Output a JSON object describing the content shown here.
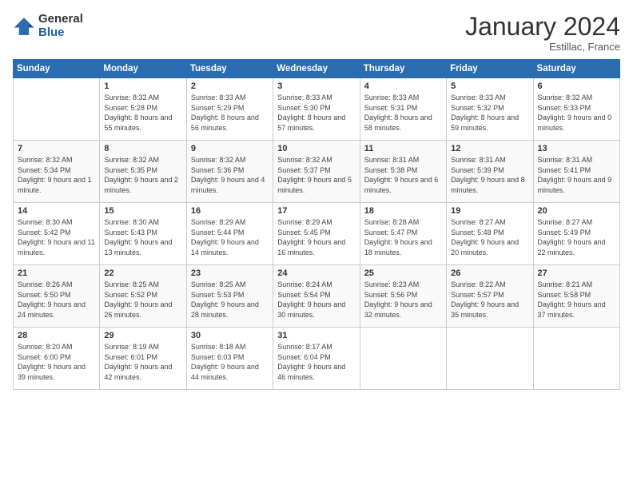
{
  "logo": {
    "general": "General",
    "blue": "Blue"
  },
  "title": "January 2024",
  "subtitle": "Estillac, France",
  "days_of_week": [
    "Sunday",
    "Monday",
    "Tuesday",
    "Wednesday",
    "Thursday",
    "Friday",
    "Saturday"
  ],
  "weeks": [
    [
      {
        "day": "",
        "sunrise": "",
        "sunset": "",
        "daylight": ""
      },
      {
        "day": "1",
        "sunrise": "Sunrise: 8:32 AM",
        "sunset": "Sunset: 5:28 PM",
        "daylight": "Daylight: 8 hours and 55 minutes."
      },
      {
        "day": "2",
        "sunrise": "Sunrise: 8:33 AM",
        "sunset": "Sunset: 5:29 PM",
        "daylight": "Daylight: 8 hours and 56 minutes."
      },
      {
        "day": "3",
        "sunrise": "Sunrise: 8:33 AM",
        "sunset": "Sunset: 5:30 PM",
        "daylight": "Daylight: 8 hours and 57 minutes."
      },
      {
        "day": "4",
        "sunrise": "Sunrise: 8:33 AM",
        "sunset": "Sunset: 5:31 PM",
        "daylight": "Daylight: 8 hours and 58 minutes."
      },
      {
        "day": "5",
        "sunrise": "Sunrise: 8:33 AM",
        "sunset": "Sunset: 5:32 PM",
        "daylight": "Daylight: 8 hours and 59 minutes."
      },
      {
        "day": "6",
        "sunrise": "Sunrise: 8:32 AM",
        "sunset": "Sunset: 5:33 PM",
        "daylight": "Daylight: 9 hours and 0 minutes."
      }
    ],
    [
      {
        "day": "7",
        "sunrise": "Sunrise: 8:32 AM",
        "sunset": "Sunset: 5:34 PM",
        "daylight": "Daylight: 9 hours and 1 minute."
      },
      {
        "day": "8",
        "sunrise": "Sunrise: 8:32 AM",
        "sunset": "Sunset: 5:35 PM",
        "daylight": "Daylight: 9 hours and 2 minutes."
      },
      {
        "day": "9",
        "sunrise": "Sunrise: 8:32 AM",
        "sunset": "Sunset: 5:36 PM",
        "daylight": "Daylight: 9 hours and 4 minutes."
      },
      {
        "day": "10",
        "sunrise": "Sunrise: 8:32 AM",
        "sunset": "Sunset: 5:37 PM",
        "daylight": "Daylight: 9 hours and 5 minutes."
      },
      {
        "day": "11",
        "sunrise": "Sunrise: 8:31 AM",
        "sunset": "Sunset: 5:38 PM",
        "daylight": "Daylight: 9 hours and 6 minutes."
      },
      {
        "day": "12",
        "sunrise": "Sunrise: 8:31 AM",
        "sunset": "Sunset: 5:39 PM",
        "daylight": "Daylight: 9 hours and 8 minutes."
      },
      {
        "day": "13",
        "sunrise": "Sunrise: 8:31 AM",
        "sunset": "Sunset: 5:41 PM",
        "daylight": "Daylight: 9 hours and 9 minutes."
      }
    ],
    [
      {
        "day": "14",
        "sunrise": "Sunrise: 8:30 AM",
        "sunset": "Sunset: 5:42 PM",
        "daylight": "Daylight: 9 hours and 11 minutes."
      },
      {
        "day": "15",
        "sunrise": "Sunrise: 8:30 AM",
        "sunset": "Sunset: 5:43 PM",
        "daylight": "Daylight: 9 hours and 13 minutes."
      },
      {
        "day": "16",
        "sunrise": "Sunrise: 8:29 AM",
        "sunset": "Sunset: 5:44 PM",
        "daylight": "Daylight: 9 hours and 14 minutes."
      },
      {
        "day": "17",
        "sunrise": "Sunrise: 8:29 AM",
        "sunset": "Sunset: 5:45 PM",
        "daylight": "Daylight: 9 hours and 16 minutes."
      },
      {
        "day": "18",
        "sunrise": "Sunrise: 8:28 AM",
        "sunset": "Sunset: 5:47 PM",
        "daylight": "Daylight: 9 hours and 18 minutes."
      },
      {
        "day": "19",
        "sunrise": "Sunrise: 8:27 AM",
        "sunset": "Sunset: 5:48 PM",
        "daylight": "Daylight: 9 hours and 20 minutes."
      },
      {
        "day": "20",
        "sunrise": "Sunrise: 8:27 AM",
        "sunset": "Sunset: 5:49 PM",
        "daylight": "Daylight: 9 hours and 22 minutes."
      }
    ],
    [
      {
        "day": "21",
        "sunrise": "Sunrise: 8:26 AM",
        "sunset": "Sunset: 5:50 PM",
        "daylight": "Daylight: 9 hours and 24 minutes."
      },
      {
        "day": "22",
        "sunrise": "Sunrise: 8:25 AM",
        "sunset": "Sunset: 5:52 PM",
        "daylight": "Daylight: 9 hours and 26 minutes."
      },
      {
        "day": "23",
        "sunrise": "Sunrise: 8:25 AM",
        "sunset": "Sunset: 5:53 PM",
        "daylight": "Daylight: 9 hours and 28 minutes."
      },
      {
        "day": "24",
        "sunrise": "Sunrise: 8:24 AM",
        "sunset": "Sunset: 5:54 PM",
        "daylight": "Daylight: 9 hours and 30 minutes."
      },
      {
        "day": "25",
        "sunrise": "Sunrise: 8:23 AM",
        "sunset": "Sunset: 5:56 PM",
        "daylight": "Daylight: 9 hours and 32 minutes."
      },
      {
        "day": "26",
        "sunrise": "Sunrise: 8:22 AM",
        "sunset": "Sunset: 5:57 PM",
        "daylight": "Daylight: 9 hours and 35 minutes."
      },
      {
        "day": "27",
        "sunrise": "Sunrise: 8:21 AM",
        "sunset": "Sunset: 5:58 PM",
        "daylight": "Daylight: 9 hours and 37 minutes."
      }
    ],
    [
      {
        "day": "28",
        "sunrise": "Sunrise: 8:20 AM",
        "sunset": "Sunset: 6:00 PM",
        "daylight": "Daylight: 9 hours and 39 minutes."
      },
      {
        "day": "29",
        "sunrise": "Sunrise: 8:19 AM",
        "sunset": "Sunset: 6:01 PM",
        "daylight": "Daylight: 9 hours and 42 minutes."
      },
      {
        "day": "30",
        "sunrise": "Sunrise: 8:18 AM",
        "sunset": "Sunset: 6:03 PM",
        "daylight": "Daylight: 9 hours and 44 minutes."
      },
      {
        "day": "31",
        "sunrise": "Sunrise: 8:17 AM",
        "sunset": "Sunset: 6:04 PM",
        "daylight": "Daylight: 9 hours and 46 minutes."
      },
      {
        "day": "",
        "sunrise": "",
        "sunset": "",
        "daylight": ""
      },
      {
        "day": "",
        "sunrise": "",
        "sunset": "",
        "daylight": ""
      },
      {
        "day": "",
        "sunrise": "",
        "sunset": "",
        "daylight": ""
      }
    ]
  ]
}
